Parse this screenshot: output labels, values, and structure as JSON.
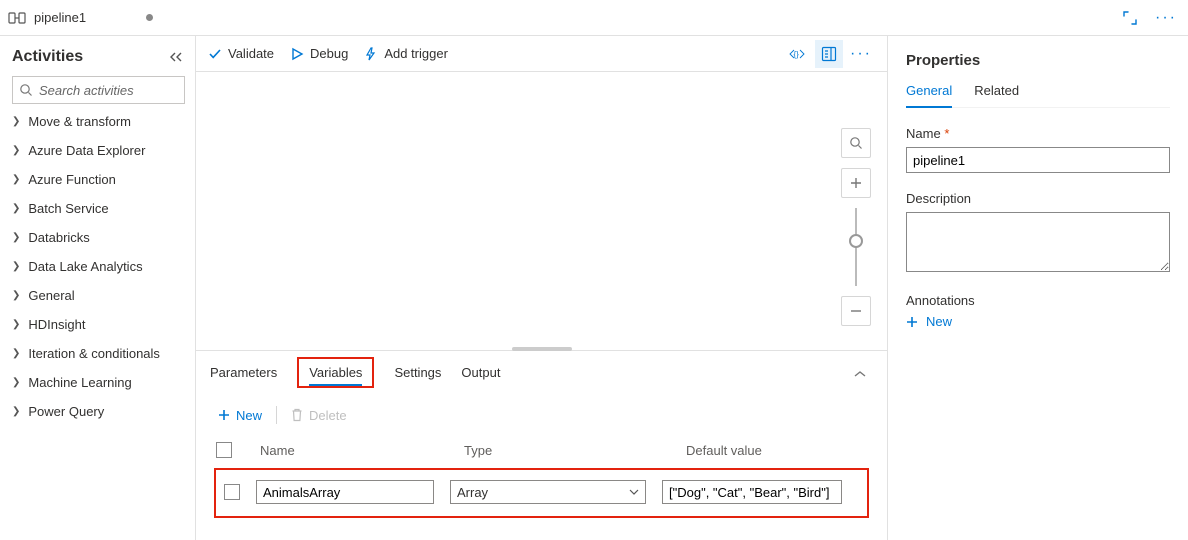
{
  "tab": {
    "title": "pipeline1"
  },
  "sidebar": {
    "title": "Activities",
    "search_placeholder": "Search activities",
    "items": [
      {
        "label": "Move & transform"
      },
      {
        "label": "Azure Data Explorer"
      },
      {
        "label": "Azure Function"
      },
      {
        "label": "Batch Service"
      },
      {
        "label": "Databricks"
      },
      {
        "label": "Data Lake Analytics"
      },
      {
        "label": "General"
      },
      {
        "label": "HDInsight"
      },
      {
        "label": "Iteration & conditionals"
      },
      {
        "label": "Machine Learning"
      },
      {
        "label": "Power Query"
      }
    ]
  },
  "toolbar": {
    "validate": "Validate",
    "debug": "Debug",
    "add_trigger": "Add trigger"
  },
  "bottom": {
    "tabs": {
      "parameters": "Parameters",
      "variables": "Variables",
      "settings": "Settings",
      "output": "Output"
    },
    "actions": {
      "new": "New",
      "delete": "Delete"
    },
    "headers": {
      "name": "Name",
      "type": "Type",
      "default": "Default value"
    },
    "row": {
      "name": "AnimalsArray",
      "type": "Array",
      "default": "[\"Dog\", \"Cat\", \"Bear\", \"Bird\"]"
    }
  },
  "props": {
    "title": "Properties",
    "tabs": {
      "general": "General",
      "related": "Related"
    },
    "name_label": "Name",
    "name_value": "pipeline1",
    "description_label": "Description",
    "annotations_label": "Annotations",
    "new": "New"
  }
}
